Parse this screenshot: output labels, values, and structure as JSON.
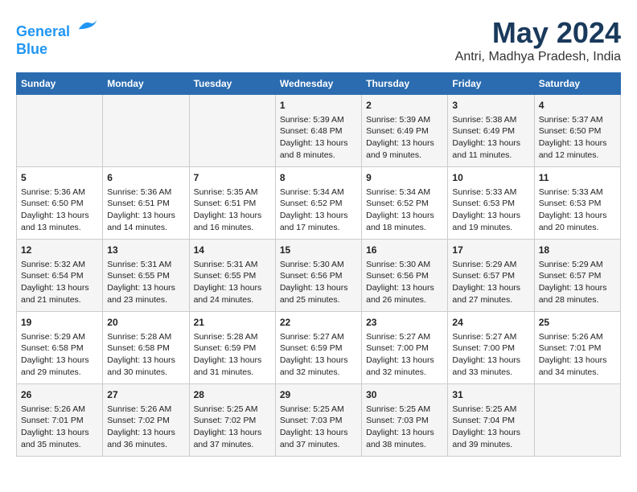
{
  "header": {
    "logo_line1": "General",
    "logo_line2": "Blue",
    "month_title": "May 2024",
    "location": "Antri, Madhya Pradesh, India"
  },
  "days_of_week": [
    "Sunday",
    "Monday",
    "Tuesday",
    "Wednesday",
    "Thursday",
    "Friday",
    "Saturday"
  ],
  "weeks": [
    [
      {
        "day": "",
        "info": ""
      },
      {
        "day": "",
        "info": ""
      },
      {
        "day": "",
        "info": ""
      },
      {
        "day": "1",
        "info": "Sunrise: 5:39 AM\nSunset: 6:48 PM\nDaylight: 13 hours\nand 8 minutes."
      },
      {
        "day": "2",
        "info": "Sunrise: 5:39 AM\nSunset: 6:49 PM\nDaylight: 13 hours\nand 9 minutes."
      },
      {
        "day": "3",
        "info": "Sunrise: 5:38 AM\nSunset: 6:49 PM\nDaylight: 13 hours\nand 11 minutes."
      },
      {
        "day": "4",
        "info": "Sunrise: 5:37 AM\nSunset: 6:50 PM\nDaylight: 13 hours\nand 12 minutes."
      }
    ],
    [
      {
        "day": "5",
        "info": "Sunrise: 5:36 AM\nSunset: 6:50 PM\nDaylight: 13 hours\nand 13 minutes."
      },
      {
        "day": "6",
        "info": "Sunrise: 5:36 AM\nSunset: 6:51 PM\nDaylight: 13 hours\nand 14 minutes."
      },
      {
        "day": "7",
        "info": "Sunrise: 5:35 AM\nSunset: 6:51 PM\nDaylight: 13 hours\nand 16 minutes."
      },
      {
        "day": "8",
        "info": "Sunrise: 5:34 AM\nSunset: 6:52 PM\nDaylight: 13 hours\nand 17 minutes."
      },
      {
        "day": "9",
        "info": "Sunrise: 5:34 AM\nSunset: 6:52 PM\nDaylight: 13 hours\nand 18 minutes."
      },
      {
        "day": "10",
        "info": "Sunrise: 5:33 AM\nSunset: 6:53 PM\nDaylight: 13 hours\nand 19 minutes."
      },
      {
        "day": "11",
        "info": "Sunrise: 5:33 AM\nSunset: 6:53 PM\nDaylight: 13 hours\nand 20 minutes."
      }
    ],
    [
      {
        "day": "12",
        "info": "Sunrise: 5:32 AM\nSunset: 6:54 PM\nDaylight: 13 hours\nand 21 minutes."
      },
      {
        "day": "13",
        "info": "Sunrise: 5:31 AM\nSunset: 6:55 PM\nDaylight: 13 hours\nand 23 minutes."
      },
      {
        "day": "14",
        "info": "Sunrise: 5:31 AM\nSunset: 6:55 PM\nDaylight: 13 hours\nand 24 minutes."
      },
      {
        "day": "15",
        "info": "Sunrise: 5:30 AM\nSunset: 6:56 PM\nDaylight: 13 hours\nand 25 minutes."
      },
      {
        "day": "16",
        "info": "Sunrise: 5:30 AM\nSunset: 6:56 PM\nDaylight: 13 hours\nand 26 minutes."
      },
      {
        "day": "17",
        "info": "Sunrise: 5:29 AM\nSunset: 6:57 PM\nDaylight: 13 hours\nand 27 minutes."
      },
      {
        "day": "18",
        "info": "Sunrise: 5:29 AM\nSunset: 6:57 PM\nDaylight: 13 hours\nand 28 minutes."
      }
    ],
    [
      {
        "day": "19",
        "info": "Sunrise: 5:29 AM\nSunset: 6:58 PM\nDaylight: 13 hours\nand 29 minutes."
      },
      {
        "day": "20",
        "info": "Sunrise: 5:28 AM\nSunset: 6:58 PM\nDaylight: 13 hours\nand 30 minutes."
      },
      {
        "day": "21",
        "info": "Sunrise: 5:28 AM\nSunset: 6:59 PM\nDaylight: 13 hours\nand 31 minutes."
      },
      {
        "day": "22",
        "info": "Sunrise: 5:27 AM\nSunset: 6:59 PM\nDaylight: 13 hours\nand 32 minutes."
      },
      {
        "day": "23",
        "info": "Sunrise: 5:27 AM\nSunset: 7:00 PM\nDaylight: 13 hours\nand 32 minutes."
      },
      {
        "day": "24",
        "info": "Sunrise: 5:27 AM\nSunset: 7:00 PM\nDaylight: 13 hours\nand 33 minutes."
      },
      {
        "day": "25",
        "info": "Sunrise: 5:26 AM\nSunset: 7:01 PM\nDaylight: 13 hours\nand 34 minutes."
      }
    ],
    [
      {
        "day": "26",
        "info": "Sunrise: 5:26 AM\nSunset: 7:01 PM\nDaylight: 13 hours\nand 35 minutes."
      },
      {
        "day": "27",
        "info": "Sunrise: 5:26 AM\nSunset: 7:02 PM\nDaylight: 13 hours\nand 36 minutes."
      },
      {
        "day": "28",
        "info": "Sunrise: 5:25 AM\nSunset: 7:02 PM\nDaylight: 13 hours\nand 37 minutes."
      },
      {
        "day": "29",
        "info": "Sunrise: 5:25 AM\nSunset: 7:03 PM\nDaylight: 13 hours\nand 37 minutes."
      },
      {
        "day": "30",
        "info": "Sunrise: 5:25 AM\nSunset: 7:03 PM\nDaylight: 13 hours\nand 38 minutes."
      },
      {
        "day": "31",
        "info": "Sunrise: 5:25 AM\nSunset: 7:04 PM\nDaylight: 13 hours\nand 39 minutes."
      },
      {
        "day": "",
        "info": ""
      }
    ]
  ]
}
